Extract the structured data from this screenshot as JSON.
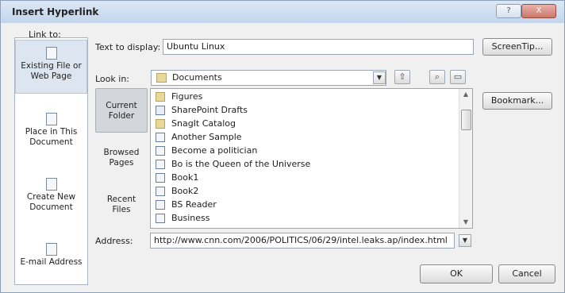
{
  "dialog": {
    "title": "Insert Hyperlink",
    "help_glyph": "?",
    "close_glyph": "X"
  },
  "link_to": {
    "label": "Link to:",
    "items": [
      {
        "label_line1": "Existing File or",
        "label_line2": "Web Page",
        "icon": "globe-document-icon",
        "active": true
      },
      {
        "label_line1": "Place in This",
        "label_line2": "Document",
        "icon": "document-place-icon",
        "active": false
      },
      {
        "label_line1": "Create New",
        "label_line2": "Document",
        "icon": "new-document-icon",
        "active": false
      },
      {
        "label_line1": "E-mail Address",
        "label_line2": "",
        "icon": "email-icon",
        "active": false
      }
    ]
  },
  "text_to_display": {
    "label": "Text to display:",
    "value": "Ubuntu Linux"
  },
  "screentip_button": "ScreenTip...",
  "look_in": {
    "label": "Look in:",
    "value": "Documents",
    "folder_icon": "folder-icon"
  },
  "toolbar_icons": [
    "up-folder-icon",
    "browse-web-icon",
    "browse-file-icon"
  ],
  "bookmark_button": "Bookmark...",
  "nav_tabs": [
    {
      "line1": "Current",
      "line2": "Folder",
      "active": true
    },
    {
      "line1": "Browsed",
      "line2": "Pages",
      "active": false
    },
    {
      "line1": "Recent",
      "line2": "Files",
      "active": false
    }
  ],
  "files": [
    {
      "name": "Figures",
      "type": "folder"
    },
    {
      "name": "SharePoint Drafts",
      "type": "sp"
    },
    {
      "name": "SnagIt Catalog",
      "type": "folder"
    },
    {
      "name": "Another Sample",
      "type": "doc"
    },
    {
      "name": "Become a politician",
      "type": "doc"
    },
    {
      "name": "Bo is the Queen of the Universe",
      "type": "doc"
    },
    {
      "name": "Book1",
      "type": "doc"
    },
    {
      "name": "Book2",
      "type": "doc"
    },
    {
      "name": "BS Reader",
      "type": "doc"
    },
    {
      "name": "Business",
      "type": "doc"
    }
  ],
  "address": {
    "label": "Address:",
    "value": "http://www.cnn.com/2006/POLITICS/06/29/intel.leaks.ap/index.html"
  },
  "ok_button": "OK",
  "cancel_button": "Cancel",
  "colors": {
    "title_bar": "#c3d5ec",
    "dialog_bg": "#f0f0f0",
    "active_nav": "#d3d7dc"
  }
}
